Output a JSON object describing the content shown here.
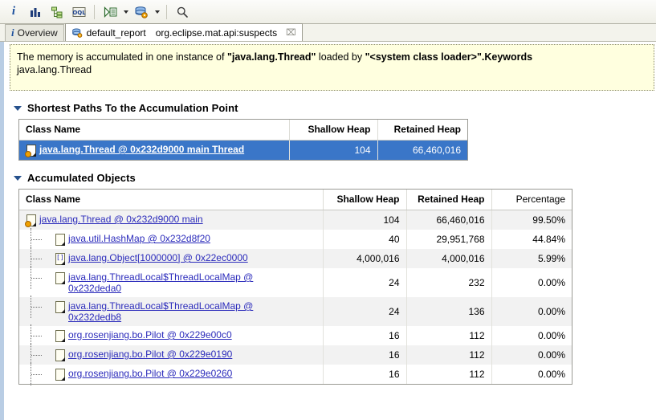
{
  "toolbar": {
    "buttons": [
      {
        "name": "info-icon",
        "glyph": "i",
        "title": "Overview info"
      },
      {
        "name": "histogram-icon",
        "glyph": "bars",
        "title": "Histogram"
      },
      {
        "name": "dominator-tree-icon",
        "glyph": "tree",
        "title": "Dominator Tree"
      },
      {
        "name": "oql-icon",
        "glyph": "OQL",
        "title": "OQL Studio"
      },
      {
        "name": "run-expert-system-icon",
        "glyph": "run",
        "title": "Run Expert System Test"
      },
      {
        "name": "query-browser-icon",
        "glyph": "db",
        "title": "Open Query Browser"
      },
      {
        "name": "search-icon",
        "glyph": "search",
        "title": "Find"
      }
    ]
  },
  "tabs": [
    {
      "label": "Overview",
      "icon": "info-icon",
      "active": false,
      "closable": false
    },
    {
      "label": "default_report",
      "sublabel": "org.eclipse.mat.api:suspects",
      "icon": "report-icon",
      "active": true,
      "closable": true,
      "close_glyph": "⌧"
    }
  ],
  "description": {
    "line1_pre": "The memory is accumulated in one instance of ",
    "line1_bold1": "\"java.lang.Thread\"",
    "line1_mid": " loaded by ",
    "line1_bold2": "\"<system class loader>\"",
    "line1_bold3": ".Keywords",
    "line2": "java.lang.Thread"
  },
  "sections": [
    {
      "title": "Shortest Paths To the Accumulation Point",
      "expanded": true,
      "table": {
        "columns": [
          "Class Name",
          "Shallow Heap",
          "Retained Heap"
        ],
        "rows": [
          {
            "name": "java.lang.Thread @ 0x232d9000 main Thread",
            "shallow": "104",
            "retained": "66,460,016",
            "selected": true,
            "icon": "thread-object-icon"
          }
        ]
      }
    },
    {
      "title": "Accumulated Objects",
      "expanded": true,
      "table": {
        "columns": [
          "Class Name",
          "Shallow Heap",
          "Retained Heap",
          "Percentage"
        ],
        "rows": [
          {
            "name": "java.lang.Thread @ 0x232d9000 main",
            "shallow": "104",
            "retained": "66,460,016",
            "percentage": "99.50%",
            "depth": 0,
            "icon": "thread-object-icon",
            "alt": true
          },
          {
            "name": "java.util.HashMap @ 0x232d8f20",
            "shallow": "40",
            "retained": "29,951,768",
            "percentage": "44.84%",
            "depth": 1,
            "icon": "object-icon",
            "alt": false
          },
          {
            "name": "java.lang.Object[1000000] @ 0x22ec0000",
            "shallow": "4,000,016",
            "retained": "4,000,016",
            "percentage": "5.99%",
            "depth": 1,
            "icon": "array-object-icon",
            "alt": true
          },
          {
            "name": "java.lang.ThreadLocal$ThreadLocalMap @ 0x232deda0",
            "shallow": "24",
            "retained": "232",
            "percentage": "0.00%",
            "depth": 1,
            "icon": "object-icon",
            "alt": false,
            "wrap": true
          },
          {
            "name": "java.lang.ThreadLocal$ThreadLocalMap @ 0x232dedb8",
            "shallow": "24",
            "retained": "136",
            "percentage": "0.00%",
            "depth": 1,
            "icon": "object-icon",
            "alt": true,
            "wrap": true
          },
          {
            "name": "org.rosenjiang.bo.Pilot @ 0x229e00c0",
            "shallow": "16",
            "retained": "112",
            "percentage": "0.00%",
            "depth": 1,
            "icon": "object-icon",
            "alt": false
          },
          {
            "name": "org.rosenjiang.bo.Pilot @ 0x229e0190",
            "shallow": "16",
            "retained": "112",
            "percentage": "0.00%",
            "depth": 1,
            "icon": "object-icon",
            "alt": true
          },
          {
            "name": "org.rosenjiang.bo.Pilot @ 0x229e0260",
            "shallow": "16",
            "retained": "112",
            "percentage": "0.00%",
            "depth": 1,
            "icon": "object-icon",
            "alt": false
          }
        ]
      }
    }
  ],
  "colors": {
    "selection_blue": "#3a76c8",
    "link_blue": "#2b2bbb",
    "description_bg": "#ffffdf",
    "rail_blue": "#b9cde4",
    "alt_row": "#f2f2f2"
  }
}
